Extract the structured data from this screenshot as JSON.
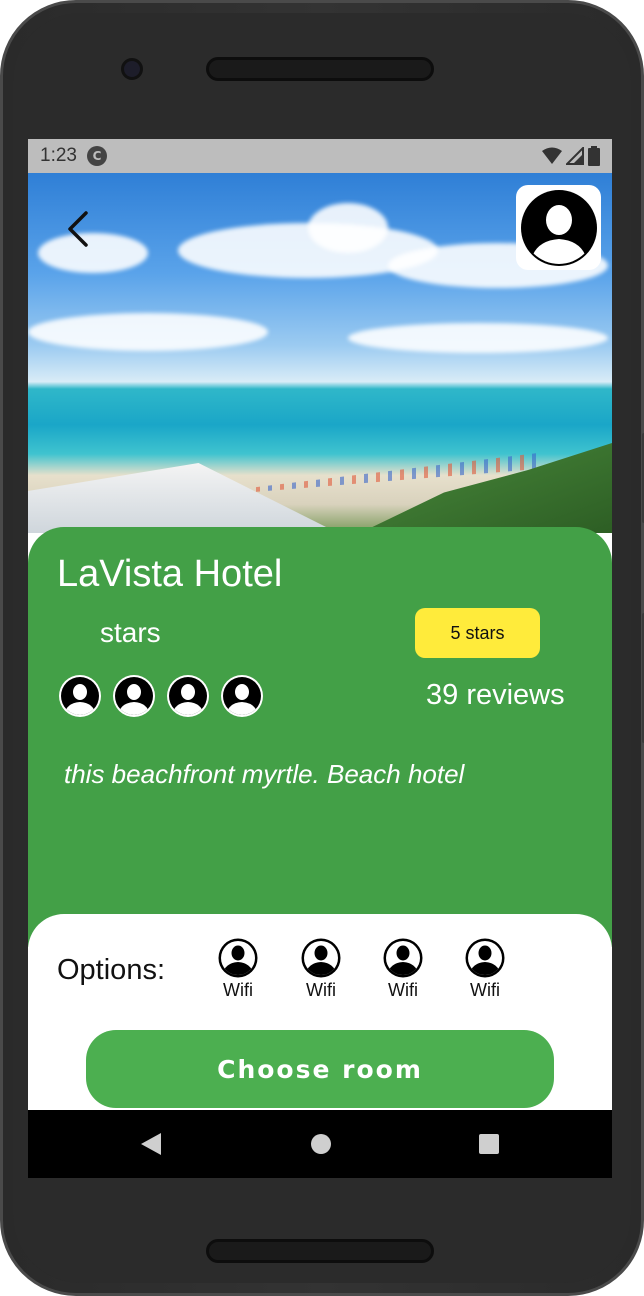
{
  "status_bar": {
    "time": "1:23",
    "app_icon_letter": "C"
  },
  "header": {
    "back_icon": "chevron-left-icon",
    "profile_icon": "user-avatar-icon"
  },
  "hotel": {
    "name": "LaVista Hotel",
    "stars_label": "stars",
    "stars_badge": "5 stars",
    "reviews": "39 reviews",
    "description": "this beachfront myrtle. Beach hotel",
    "reviewer_avatars": [
      "user-avatar-icon",
      "user-avatar-icon",
      "user-avatar-icon",
      "user-avatar-icon"
    ]
  },
  "options": {
    "label": "Options:",
    "items": [
      {
        "label": "Wifi",
        "icon": "user-avatar-icon"
      },
      {
        "label": "Wifi",
        "icon": "user-avatar-icon"
      },
      {
        "label": "Wifi",
        "icon": "user-avatar-icon"
      },
      {
        "label": "Wifi",
        "icon": "user-avatar-icon"
      }
    ]
  },
  "actions": {
    "choose_room": "Choose room"
  },
  "colors": {
    "primary_green": "#43a047",
    "button_green": "#4caf50",
    "badge_yellow": "#ffeb3b"
  }
}
